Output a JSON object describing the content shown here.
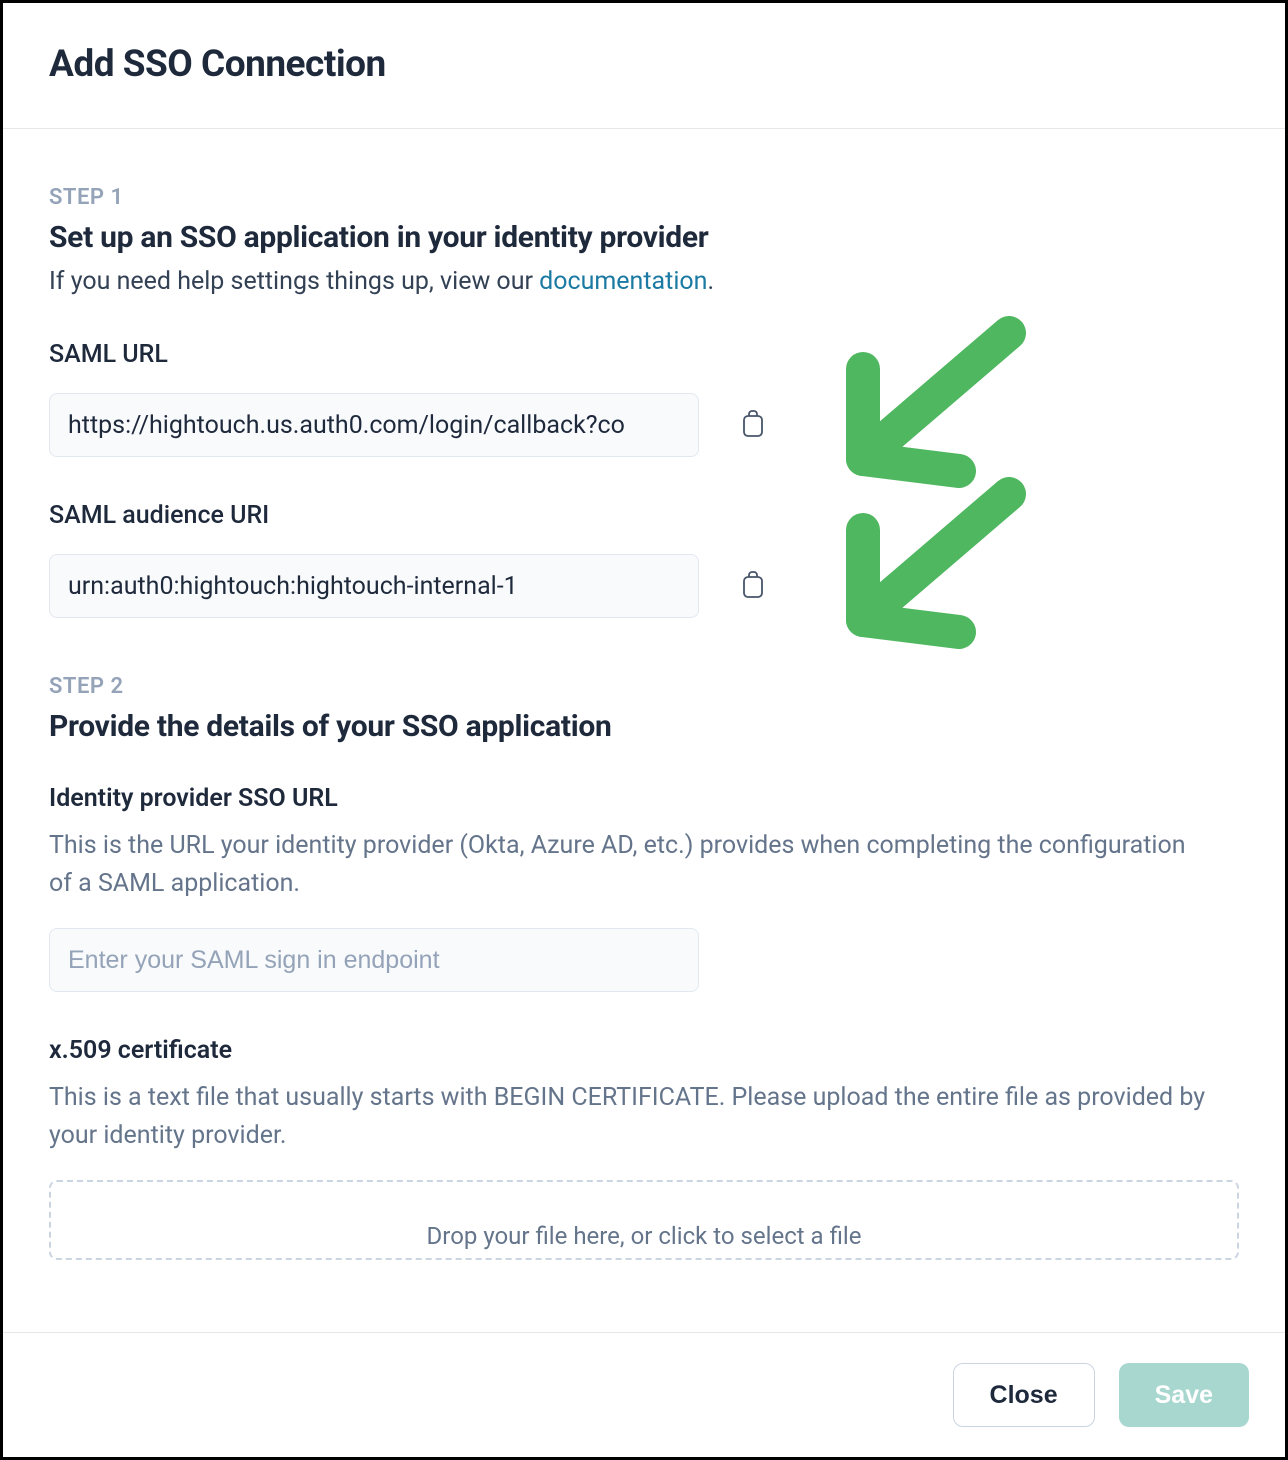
{
  "header": {
    "title": "Add SSO Connection"
  },
  "step1": {
    "label": "STEP 1",
    "title": "Set up an SSO application in your identity provider",
    "help_prefix": "If you need help settings things up, view our ",
    "help_link_text": "documentation",
    "help_suffix": ".",
    "saml_url": {
      "label": "SAML URL",
      "value": "https://hightouch.us.auth0.com/login/callback?co"
    },
    "saml_audience": {
      "label": "SAML audience URI",
      "value": "urn:auth0:hightouch:hightouch-internal-1"
    }
  },
  "step2": {
    "label": "STEP 2",
    "title": "Provide the details of your SSO application",
    "idp_url": {
      "label": "Identity provider SSO URL",
      "help": "This is the URL your identity provider (Okta, Azure AD, etc.) provides when completing the configuration of a SAML application.",
      "placeholder": "Enter your SAML sign in endpoint",
      "value": ""
    },
    "cert": {
      "label": "x.509 certificate",
      "help": "This is a text file that usually starts with BEGIN CERTIFICATE. Please upload the entire file as provided by your identity provider.",
      "dropzone_text": "Drop your file here, or click to select a file"
    }
  },
  "footer": {
    "close": "Close",
    "save": "Save"
  },
  "colors": {
    "arrow": "#4fb75f",
    "link": "#1b7aa3",
    "muted": "#64748b",
    "save_bg": "#a7d7cf"
  }
}
